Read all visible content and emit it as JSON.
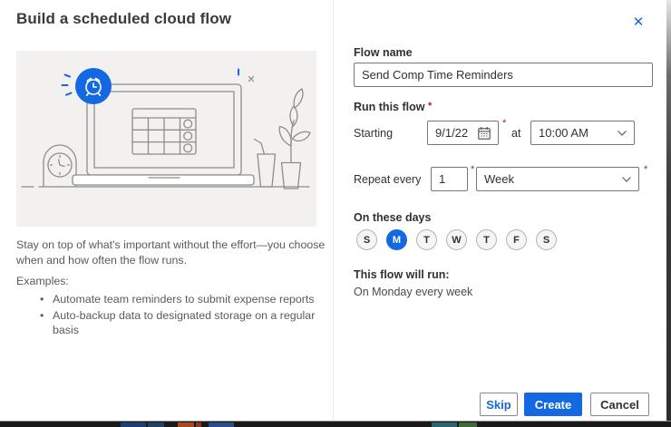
{
  "dialog": {
    "title": "Build a scheduled cloud flow"
  },
  "icons": {
    "close": "✕",
    "calendar": "calendar-outline",
    "chevron_down": "chevron-down",
    "illustration": "laptop-calendar-alarm-scene"
  },
  "left": {
    "description": "Stay on top of what's important without the effort—you choose when and how often the flow runs.",
    "examples_label": "Examples:",
    "examples": [
      "Automate team reminders to submit expense reports",
      "Auto-backup data to designated storage on a regular basis"
    ]
  },
  "form": {
    "flow_name_label": "Flow name",
    "flow_name_value": "Send Comp Time Reminders",
    "run_this_flow_label": "Run this flow",
    "required_mark": "*",
    "starting_label": "Starting",
    "starting_date": "9/1/22",
    "at_label": "at",
    "starting_time": "10:00 AM",
    "repeat_every_label": "Repeat every",
    "repeat_interval": "1",
    "repeat_frequency": "Week",
    "on_these_days_label": "On these days",
    "days": [
      {
        "label": "S",
        "selected": false
      },
      {
        "label": "M",
        "selected": true
      },
      {
        "label": "T",
        "selected": false
      },
      {
        "label": "W",
        "selected": false
      },
      {
        "label": "T",
        "selected": false
      },
      {
        "label": "F",
        "selected": false
      },
      {
        "label": "S",
        "selected": false
      }
    ],
    "summary_label": "This flow will run:",
    "summary_text": "On Monday every week"
  },
  "buttons": {
    "skip": "Skip",
    "create": "Create",
    "cancel": "Cancel"
  },
  "colors": {
    "accent": "#1468e2",
    "required": "#a4262c",
    "selected_day": "#1468e2"
  }
}
